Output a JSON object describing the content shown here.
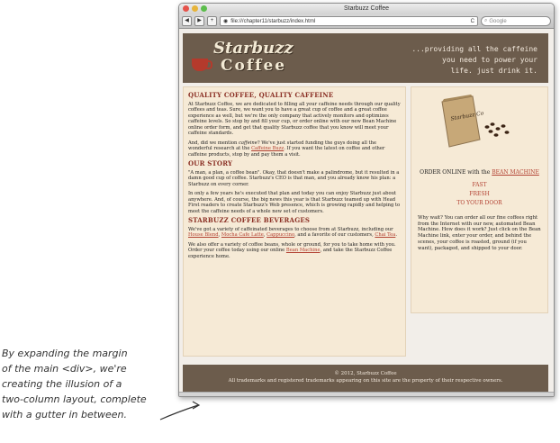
{
  "browser": {
    "title": "Starbuzz Coffee",
    "url": "file:///chapter11/starbuzz/index.html",
    "search_placeholder": "Google",
    "back_icon": "◀",
    "forward_icon": "▶",
    "add_icon": "+",
    "reload_icon": "C"
  },
  "header": {
    "logo_line1": "Starbuzz",
    "logo_line2": "Coffee",
    "tagline_1": "...providing all the caffeine",
    "tagline_2": "you need to power your",
    "tagline_3": "life. just drink it."
  },
  "main": {
    "heading1": "QUALITY COFFEE, QUALITY CAFFEINE",
    "p1": "At Starbuzz Coffee, we are dedicated to filling all your caffeine needs through our quality coffees and teas. Sure, we want you to have a great cup of coffee and a great coffee experience as well, but we're the only company that actively monitors and optimizes caffeine levels. So stop by and fill your cup, or order online with our new Bean Machine online order form, and get that quality Starbuzz coffee that you know will meet your caffeine standards.",
    "p2_a": "And, did we mention ",
    "p2_em": "caffeine",
    "p2_b": "? We've just started funding the guys doing all the wonderful research at the ",
    "p2_link": "Caffeine Buzz",
    "p2_c": ". If you want the latest on coffee and other caffeine products, stop by and pay them a visit.",
    "heading2": "OUR STORY",
    "p3": "\"A man, a plan, a coffee bean\". Okay, that doesn't make a palindrome, but it resulted in a damn good cup of coffee. Starbuzz's CEO is that man, and you already know his plan: a Starbuzz on every corner.",
    "p4": "In only a few years he's executed that plan and today you can enjoy Starbuzz just about anywhere. And, of course, the big news this year is that Starbuzz teamed up with Head First readers to create Starbuzz's Web presence, which is growing rapidly and helping to meet the caffeine needs of a whole new set of customers.",
    "heading3": "STARBUZZ COFFEE BEVERAGES",
    "p5_a": "We've got a variety of caffeinated beverages to choose from at Starbuzz, including our ",
    "p5_link1": "House Blend",
    "p5_sep1": ", ",
    "p5_link2": "Mocha Cafe Latte",
    "p5_sep2": ", ",
    "p5_link3": "Cappuccino",
    "p5_b": ", and a favorite of our customers, ",
    "p5_link4": "Chai Tea",
    "p5_c": ".",
    "p6_a": "We also offer a variety of coffee beans, whole or ground, for you to take home with you. Order your coffee today using our online ",
    "p6_link": "Bean Machine",
    "p6_b": ", and take the Starbuzz Coffee experience home."
  },
  "sidebar": {
    "bag_label": "Starbuzz Coffee",
    "order_prefix": "ORDER ONLINE with the ",
    "order_link": "BEAN MACHINE",
    "fast": "FAST",
    "fresh": "FRESH",
    "to_door": "TO YOUR DOOR",
    "text": "Why wait? You can order all our fine coffees right from the Internet with our new, automated Bean Machine. How does it work? Just click on the Bean Machine link, enter your order, and behind the scenes, your coffee is roasted, ground (if you want), packaged, and shipped to your door."
  },
  "footer": {
    "line1": "© 2012, Starbuzz Coffee",
    "line2": "All trademarks and registered trademarks appearing on this site are the property of their respective owners."
  },
  "annotation": {
    "line1": "By expanding the margin",
    "line2": "of the main <div>, we're",
    "line3": "creating the illusion of a",
    "line4": "two-column layout, complete",
    "line5": "with a gutter in between."
  },
  "colors": {
    "header_bg": "#6c5c4c",
    "content_bg": "#f6ead6",
    "heading": "#8a2f24",
    "link": "#b24132"
  }
}
